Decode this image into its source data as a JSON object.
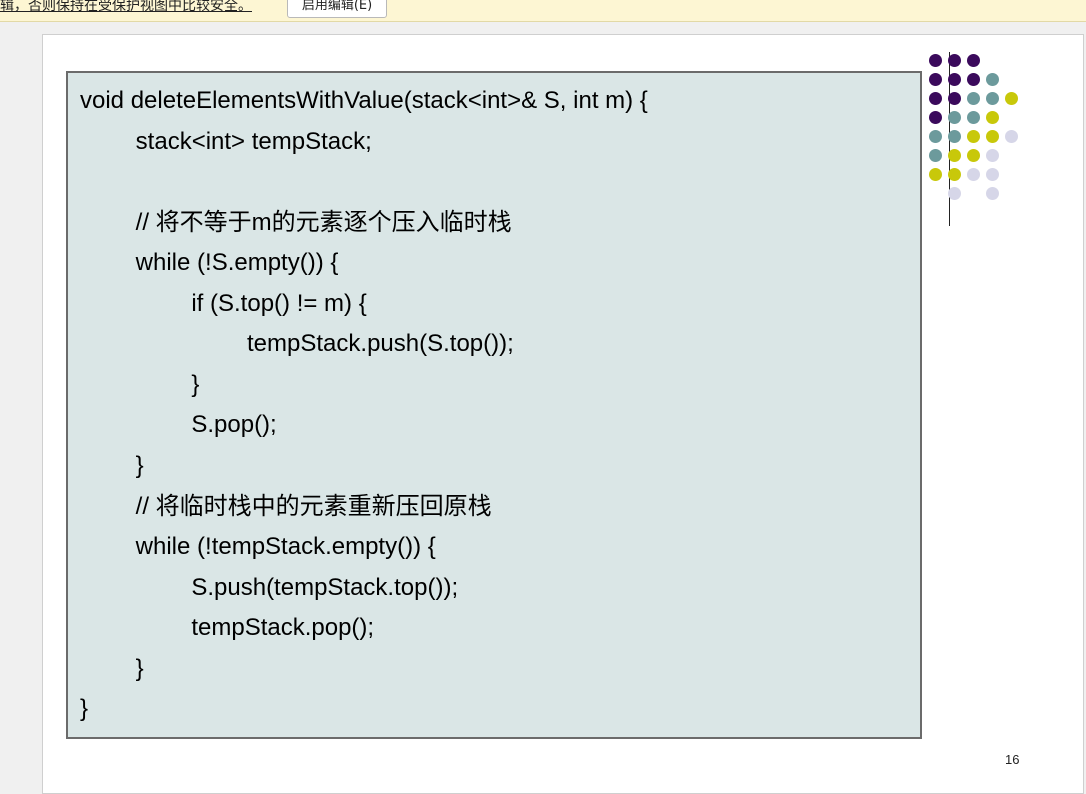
{
  "protected_view_bar": {
    "message": "辑，否则保持在受保护视图中比较安全。",
    "enable_button": "启用编辑(E)"
  },
  "slide": {
    "code_lines": [
      "void deleteElementsWithValue(stack<int>& S, int m) {",
      "    stack<int> tempStack;",
      "",
      "    // 将不等于m的元素逐个压入临时栈",
      "    while (!S.empty()) {",
      "        if (S.top() != m) {",
      "            tempStack.push(S.top());",
      "        }",
      "        S.pop();",
      "    }",
      "    // 将临时栈中的元素重新压回原栈",
      "    while (!tempStack.empty()) {",
      "        S.push(tempStack.top());",
      "        tempStack.pop();",
      "    }",
      "}"
    ],
    "page_number": "16",
    "decoration_colors": {
      "purple": "#3b0a5c",
      "teal": "#6c9a9c",
      "olive": "#c8c80a",
      "lavender": "#d6d6e8"
    }
  }
}
